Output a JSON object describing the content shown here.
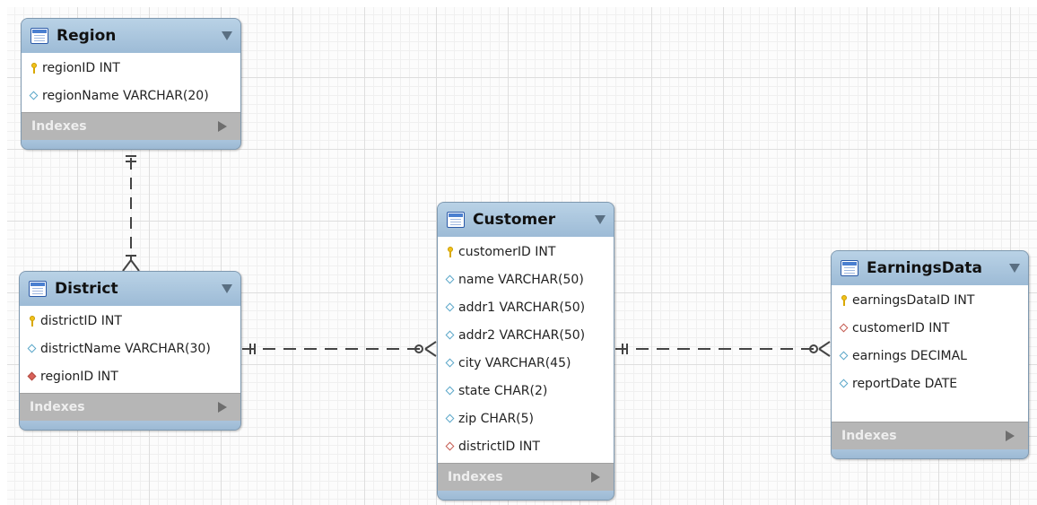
{
  "entities": {
    "region": {
      "name": "Region",
      "columns": [
        {
          "text": "regionID INT",
          "kind": "primary-key"
        },
        {
          "text": "regionName VARCHAR(20)",
          "kind": "column"
        }
      ],
      "indexes_label": "Indexes"
    },
    "district": {
      "name": "District",
      "columns": [
        {
          "text": "districtID INT",
          "kind": "primary-key"
        },
        {
          "text": "districtName VARCHAR(30)",
          "kind": "column"
        },
        {
          "text": "regionID INT",
          "kind": "foreign-key-not-null"
        }
      ],
      "indexes_label": "Indexes"
    },
    "customer": {
      "name": "Customer",
      "columns": [
        {
          "text": "customerID INT",
          "kind": "primary-key"
        },
        {
          "text": "name VARCHAR(50)",
          "kind": "column"
        },
        {
          "text": "addr1 VARCHAR(50)",
          "kind": "column"
        },
        {
          "text": "addr2 VARCHAR(50)",
          "kind": "column"
        },
        {
          "text": "city VARCHAR(45)",
          "kind": "column"
        },
        {
          "text": "state CHAR(2)",
          "kind": "column"
        },
        {
          "text": "zip CHAR(5)",
          "kind": "column"
        },
        {
          "text": "districtID INT",
          "kind": "foreign-key"
        }
      ],
      "indexes_label": "Indexes"
    },
    "earnings": {
      "name": "EarningsData",
      "columns": [
        {
          "text": "earningsDataID INT",
          "kind": "primary-key"
        },
        {
          "text": "customerID INT",
          "kind": "foreign-key"
        },
        {
          "text": "earnings DECIMAL",
          "kind": "column"
        },
        {
          "text": "reportDate DATE",
          "kind": "column"
        }
      ],
      "indexes_label": "Indexes"
    }
  },
  "relationships": [
    {
      "from": "Region",
      "to": "District",
      "from_cardinality": "one",
      "to_cardinality": "one-or-many",
      "line": "dashed"
    },
    {
      "from": "District",
      "to": "Customer",
      "from_cardinality": "one",
      "to_cardinality": "zero-or-many",
      "line": "dashed"
    },
    {
      "from": "Customer",
      "to": "EarningsData",
      "from_cardinality": "one",
      "to_cardinality": "zero-or-many",
      "line": "dashed"
    }
  ],
  "colors": {
    "entity_header": "#a9c4dc",
    "indexes_bar": "#b6b6b6",
    "connector": "#444444",
    "primary_key_icon": "#f2c21a",
    "foreign_key_icon": "#d9615a",
    "column_icon": "#5aa6c8"
  }
}
